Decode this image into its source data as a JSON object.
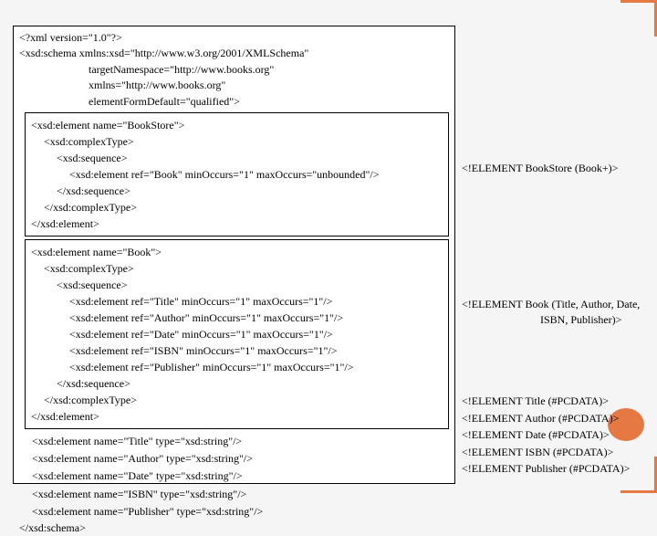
{
  "schema": {
    "xml_decl": "<?xml version=\"1.0\"?>",
    "open1": "<xsd:schema xmlns:xsd=\"http://www.w3.org/2001/XMLSchema\"",
    "open2": "targetNamespace=\"http://www.books.org\"",
    "open3": "xmlns=\"http://www.books.org\"",
    "open4": "elementFormDefault=\"qualified\">",
    "close": "</xsd:schema>"
  },
  "bookstore": {
    "l1": "<xsd:element name=\"BookStore\">",
    "l2": "<xsd:complexType>",
    "l3": "<xsd:sequence>",
    "l4": "<xsd:element ref=\"Book\" minOccurs=\"1\" maxOccurs=\"unbounded\"/>",
    "l5": "</xsd:sequence>",
    "l6": "</xsd:complexType>",
    "l7": "</xsd:element>"
  },
  "book": {
    "l1": "<xsd:element name=\"Book\">",
    "l2": "<xsd:complexType>",
    "l3": "<xsd:sequence>",
    "l4": "<xsd:element ref=\"Title\" minOccurs=\"1\" maxOccurs=\"1\"/>",
    "l5": "<xsd:element ref=\"Author\" minOccurs=\"1\" maxOccurs=\"1\"/>",
    "l6": "<xsd:element ref=\"Date\" minOccurs=\"1\" maxOccurs=\"1\"/>",
    "l7": "<xsd:element ref=\"ISBN\" minOccurs=\"1\" maxOccurs=\"1\"/>",
    "l8": "<xsd:element ref=\"Publisher\" minOccurs=\"1\" maxOccurs=\"1\"/>",
    "l9": "</xsd:sequence>",
    "l10": "</xsd:complexType>",
    "l11": "</xsd:element>"
  },
  "simple": {
    "l1": "<xsd:element name=\"Title\" type=\"xsd:string\"/>",
    "l2": "<xsd:element name=\"Author\" type=\"xsd:string\"/>",
    "l3": "<xsd:element name=\"Date\" type=\"xsd:string\"/>",
    "l4": "<xsd:element name=\"ISBN\" type=\"xsd:string\"/>",
    "l5": "<xsd:element name=\"Publisher\" type=\"xsd:string\"/>"
  },
  "dtd": {
    "bookstore": "<!ELEMENT BookStore (Book+)>",
    "book1": "<!ELEMENT Book (Title, Author, Date,",
    "book2": "ISBN, Publisher)>",
    "title": "<!ELEMENT Title (#PCDATA)>",
    "author": "<!ELEMENT Author (#PCDATA)>",
    "date": "<!ELEMENT Date (#PCDATA)>",
    "isbn": "<!ELEMENT ISBN (#PCDATA)>",
    "publisher": "<!ELEMENT Publisher (#PCDATA)>"
  }
}
